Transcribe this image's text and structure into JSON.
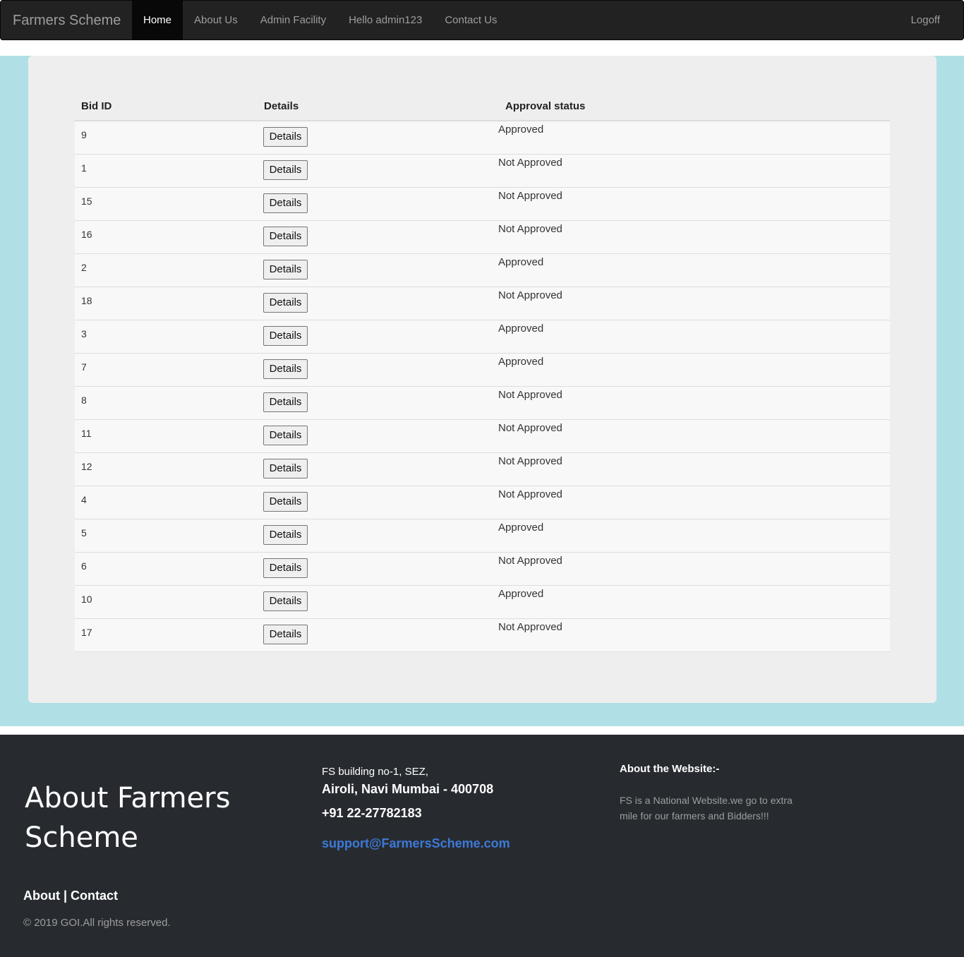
{
  "navbar": {
    "brand": "Farmers Scheme",
    "items": [
      {
        "label": "Home",
        "active": true
      },
      {
        "label": "About Us",
        "active": false
      },
      {
        "label": "Admin Facility",
        "active": false
      },
      {
        "label": "Hello admin123",
        "active": false
      },
      {
        "label": "Contact Us",
        "active": false
      }
    ],
    "logoff": "Logoff"
  },
  "table": {
    "headers": {
      "bid_id": "Bid ID",
      "details": "Details",
      "status": "Approval status"
    },
    "button_label": "Details",
    "rows": [
      {
        "bid_id": "9",
        "status": "Approved"
      },
      {
        "bid_id": "1",
        "status": "Not Approved"
      },
      {
        "bid_id": "15",
        "status": "Not Approved"
      },
      {
        "bid_id": "16",
        "status": "Not Approved"
      },
      {
        "bid_id": "2",
        "status": "Approved"
      },
      {
        "bid_id": "18",
        "status": "Not Approved"
      },
      {
        "bid_id": "3",
        "status": "Approved"
      },
      {
        "bid_id": "7",
        "status": "Approved"
      },
      {
        "bid_id": "8",
        "status": "Not Approved"
      },
      {
        "bid_id": "11",
        "status": "Not Approved"
      },
      {
        "bid_id": "12",
        "status": "Not Approved"
      },
      {
        "bid_id": "4",
        "status": "Not Approved"
      },
      {
        "bid_id": "5",
        "status": "Approved"
      },
      {
        "bid_id": "6",
        "status": "Not Approved"
      },
      {
        "bid_id": "10",
        "status": "Approved"
      },
      {
        "bid_id": "17",
        "status": "Not Approved"
      }
    ]
  },
  "footer": {
    "about_title": "About Farmers Scheme",
    "links": "About | Contact",
    "copyright": "© 2019 GOI.All rights reserved.",
    "address_line1": "FS building no-1, SEZ,",
    "address_line2": "Airoli, Navi Mumbai - 400708",
    "phone": "+91 22-27782183",
    "email": "support@FarmersScheme.com",
    "website_title": "About the Website:-",
    "website_text": "FS is a National Website.we go to extra mile for our farmers and Bidders!!!"
  },
  "colors": {
    "navbar_bg": "#222222",
    "page_bg": "#b0e0e6",
    "panel_bg": "#eeeeee",
    "footer_bg": "#272b30",
    "email_link": "#3e79d6"
  }
}
